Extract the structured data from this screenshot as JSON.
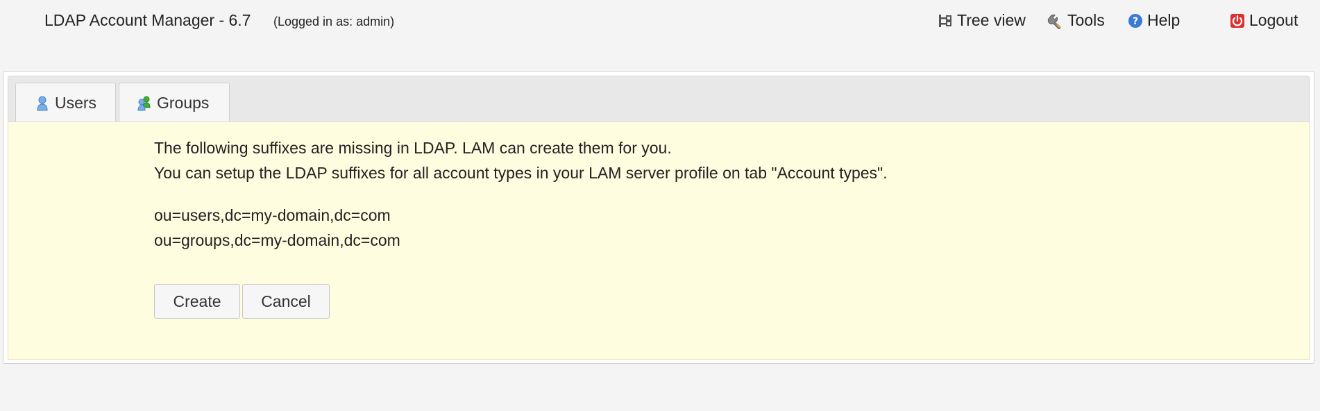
{
  "header": {
    "app_title": "LDAP Account Manager - 6.7",
    "logged_in": "(Logged in as: admin)",
    "nav": {
      "tree_view": "Tree view",
      "tools": "Tools",
      "help": "Help",
      "logout": "Logout"
    }
  },
  "tabs": [
    {
      "label": "Users",
      "icon": "user-icon"
    },
    {
      "label": "Groups",
      "icon": "group-icon"
    }
  ],
  "message": {
    "line1": "The following suffixes are missing in LDAP. LAM can create them for you.",
    "line2": "You can setup the LDAP suffixes for all account types in your LAM server profile on tab \"Account types\"."
  },
  "suffixes": [
    "ou=users,dc=my-domain,dc=com",
    "ou=groups,dc=my-domain,dc=com"
  ],
  "buttons": {
    "create": "Create",
    "cancel": "Cancel"
  },
  "colors": {
    "page_background": "#f4f4f4",
    "content_background": "#fffde0",
    "help_icon": "#3a7bd5",
    "logout_icon": "#d9322f",
    "group_icon_accent": "#3cae3c"
  }
}
